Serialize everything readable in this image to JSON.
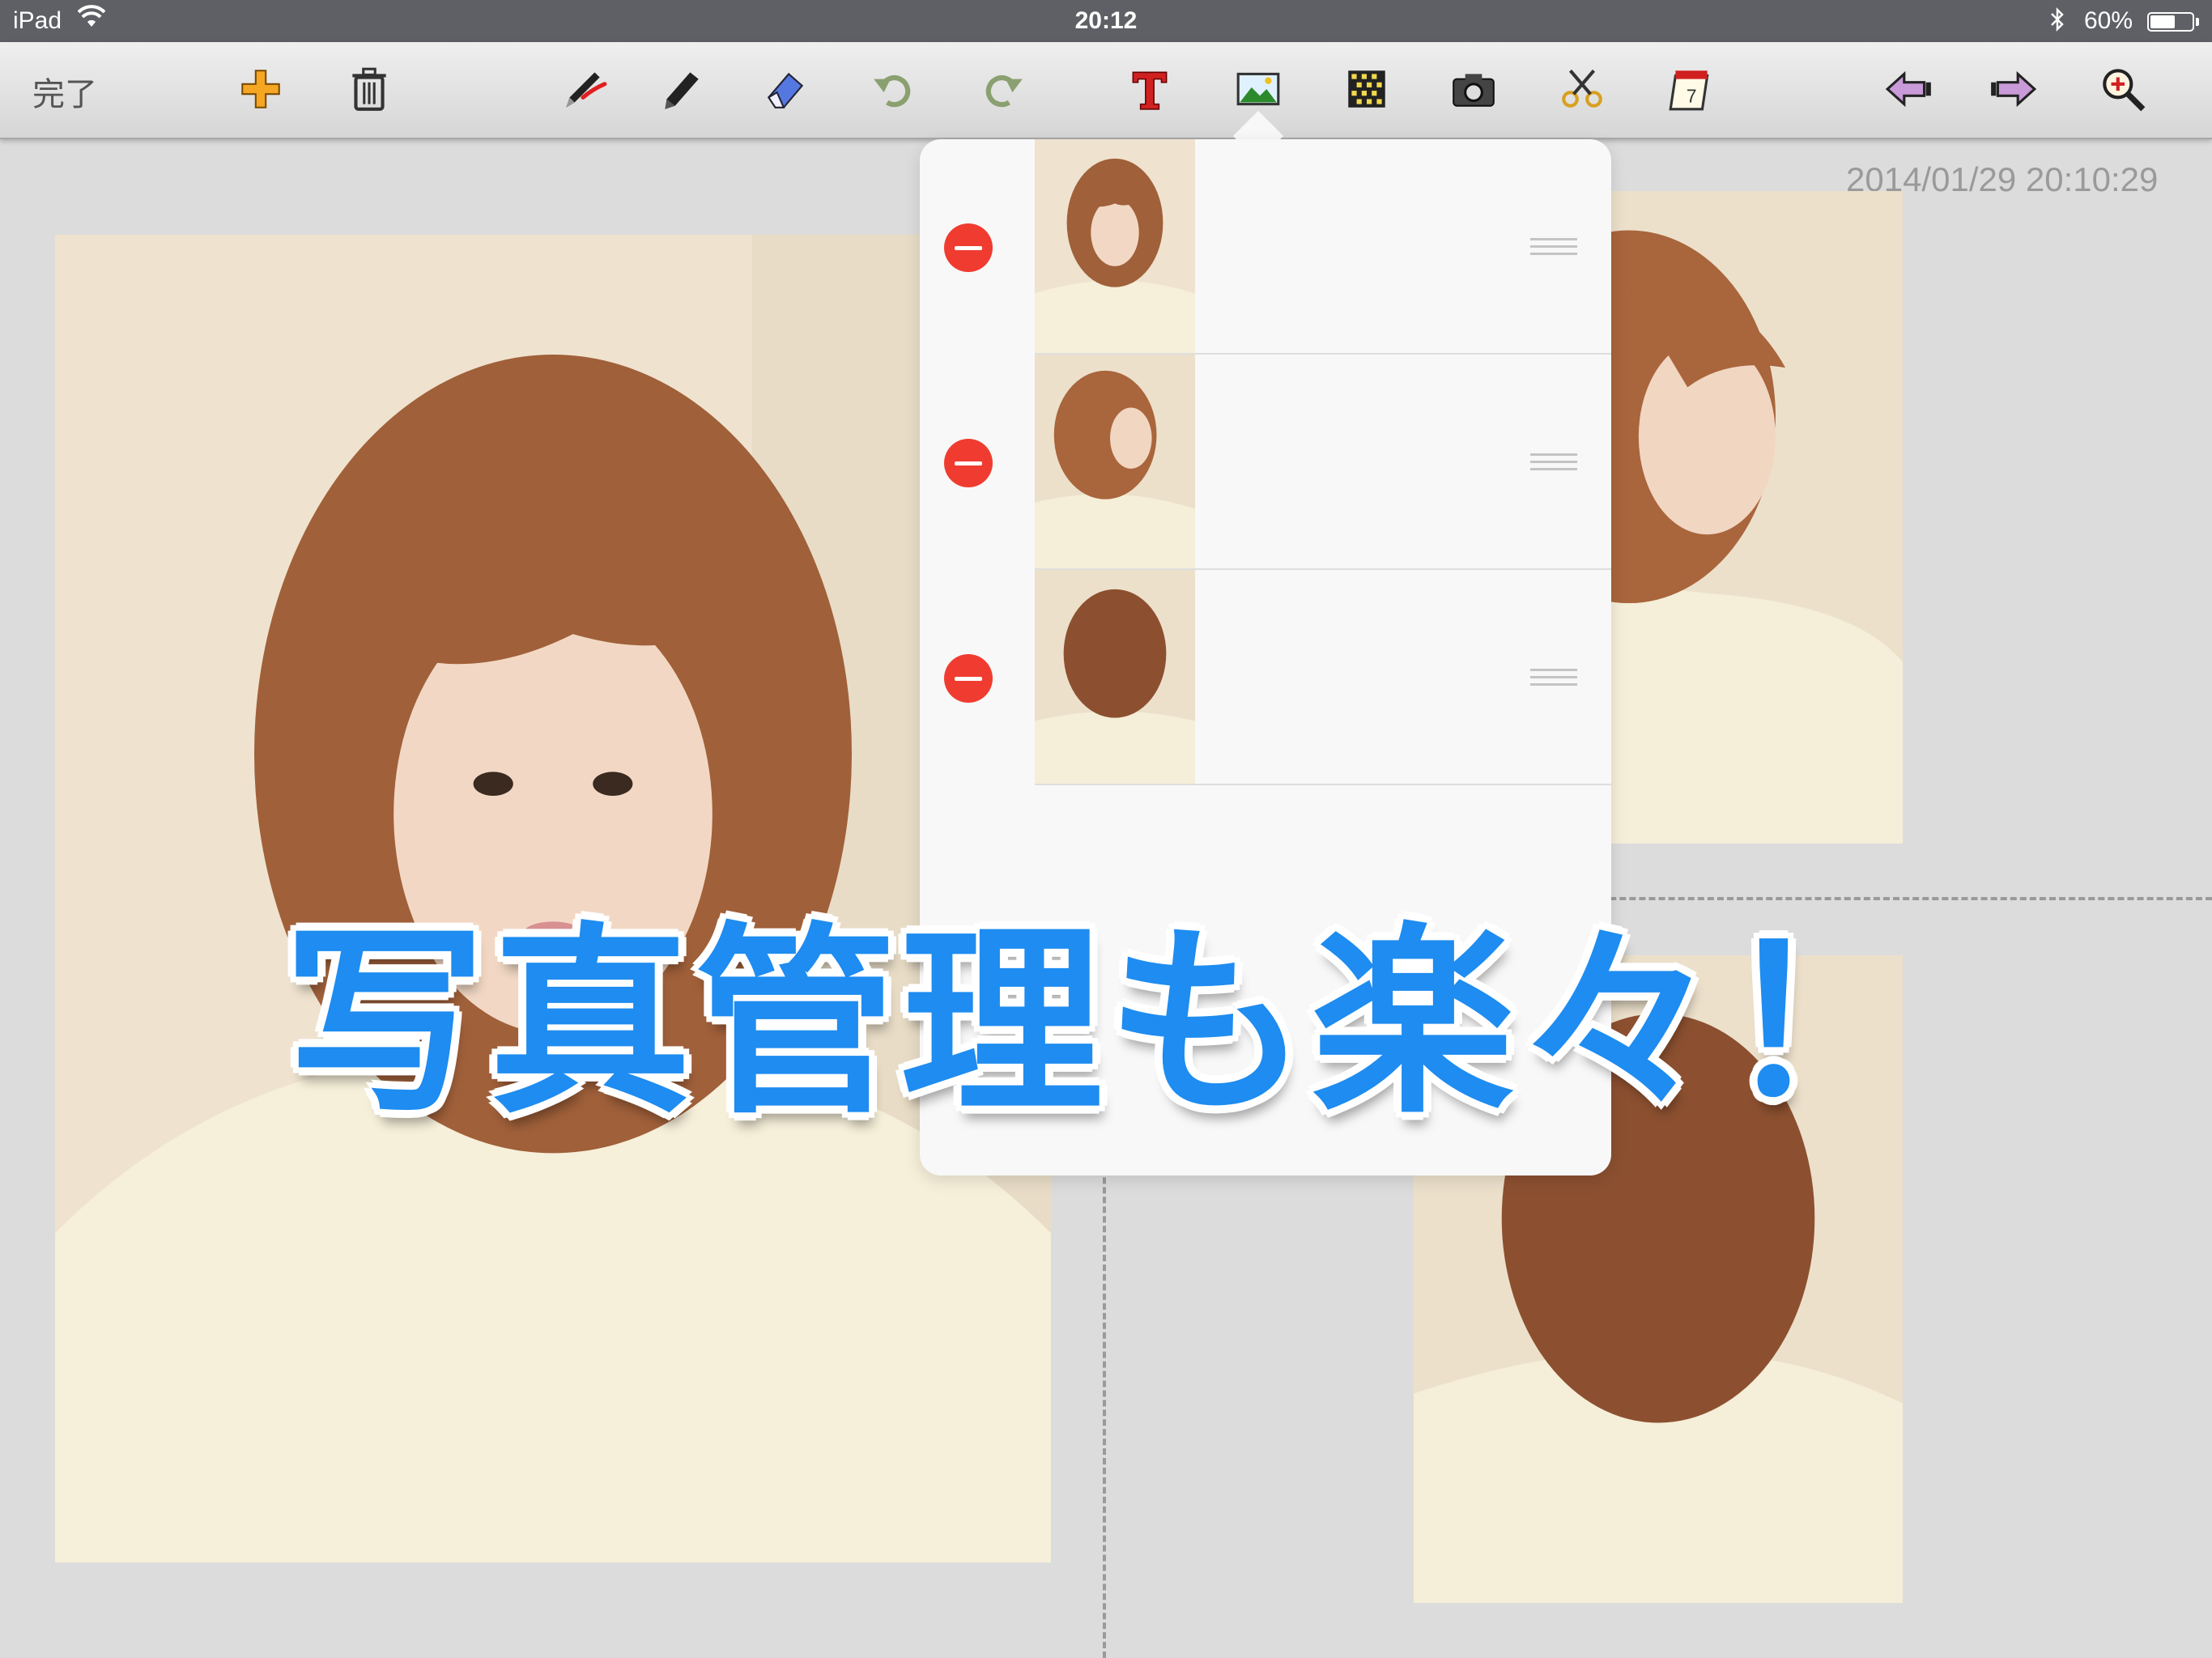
{
  "status_bar": {
    "device": "iPad",
    "time": "20:12",
    "battery_percent": "60%",
    "battery_level": 0.6
  },
  "toolbar": {
    "done_label": "完了",
    "tools": [
      "add-icon",
      "trash-icon",
      "red-pen-icon",
      "marker-icon",
      "eraser-icon",
      "undo-icon",
      "redo-icon",
      "text-icon",
      "image-icon",
      "pattern-icon",
      "camera-icon",
      "scissors-icon",
      "calendar-icon",
      "prev-page-icon",
      "next-page-icon",
      "zoom-icon"
    ],
    "active_tool": "image-icon"
  },
  "page": {
    "date_stamp": "2014/01/29 20:10:29"
  },
  "popover": {
    "rows": [
      {
        "photo": "front-view-thumbnail"
      },
      {
        "photo": "side-view-thumbnail"
      },
      {
        "photo": "back-view-thumbnail"
      }
    ]
  },
  "caption": "写真管理も楽々！",
  "colors": {
    "caption": "#1e8cf0",
    "delete": "#f03c30",
    "toolbar": "#e2e2e2",
    "canvas": "#dcdcdc"
  }
}
